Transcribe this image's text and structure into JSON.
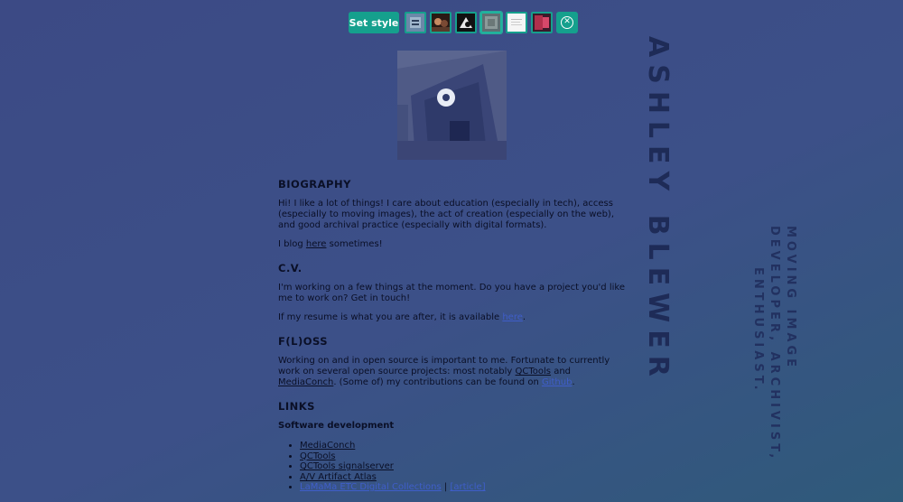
{
  "toolbar": {
    "set_style_label": "Set style",
    "thumbnails": [
      {
        "name": "style-thumb-1",
        "color": "#6b88a8"
      },
      {
        "name": "style-thumb-2",
        "color": "#5a3a2a"
      },
      {
        "name": "style-thumb-3",
        "color": "#222222"
      },
      {
        "name": "style-thumb-4",
        "color": "#7e8c8c"
      },
      {
        "name": "style-thumb-5",
        "color": "#f3f3f3"
      },
      {
        "name": "style-thumb-6",
        "color": "#8a2540"
      }
    ],
    "close_icon": "close-circle-icon"
  },
  "side": {
    "name": "ASHLEY BLEWER",
    "tag_col1": "MOVING IMAGE",
    "tag_col2": "DEVELOPER, ARCHIVIST,",
    "tag_col3": "ENTHUSIAST."
  },
  "bio": {
    "heading": "BIOGRAPHY",
    "para": "Hi! I like a lot of things! I care about education (especially in tech), access (especially to moving images), the act of creation (especially on the web), and good archival practice (especially with digital formats).",
    "blog_pre": "I blog ",
    "blog_link": "here",
    "blog_post": " sometimes!"
  },
  "cv": {
    "heading": "C.V.",
    "para": "I'm working on a few things at the moment. Do you have a project you'd like me to work on? Get in touch!",
    "resume_pre": "If my resume is what you are after, it is available ",
    "resume_link": "here",
    "resume_post": "."
  },
  "floss": {
    "heading": "F(L)OSS",
    "para_pre": "Working on and in open source is important to me. Fortunate to currently work on several open source projects: most notably ",
    "link1": "QCTools",
    "and": " and ",
    "link2": "MediaConch",
    "para_mid": ". (Some of) my contributions can be found on ",
    "link3": "Github",
    "para_post": "."
  },
  "links": {
    "heading": "LINKS",
    "subheading": "Software development",
    "items": [
      "MediaConch",
      "QCTools",
      "QCTools signalserver",
      "A/V Artifact Atlas",
      "LaMaMa ETC Digital Collections"
    ],
    "extra_sep": " | ",
    "extra_link": "[article]"
  }
}
